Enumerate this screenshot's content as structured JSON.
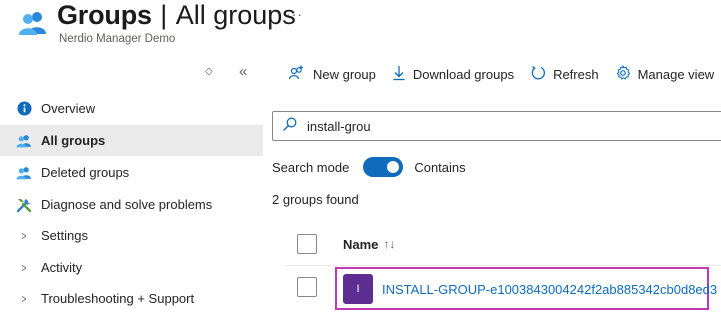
{
  "header": {
    "title_main": "Groups",
    "title_separator": "|",
    "title_sub": "All groups",
    "subtitle": "Nerdio Manager Demo",
    "more_label": "···",
    "icon": "groups-icon"
  },
  "sidebar": {
    "tools": {
      "updown": "◇",
      "collapse": "«"
    },
    "items": [
      {
        "label": "Overview",
        "icon": "info-icon",
        "active": false
      },
      {
        "label": "All groups",
        "icon": "groups-icon",
        "active": true
      },
      {
        "label": "Deleted groups",
        "icon": "groups-icon",
        "active": false
      },
      {
        "label": "Diagnose and solve problems",
        "icon": "wrench-icon",
        "active": false
      },
      {
        "label": "Settings",
        "icon": "chevron-right-icon",
        "active": false
      },
      {
        "label": "Activity",
        "icon": "chevron-right-icon",
        "active": false
      },
      {
        "label": "Troubleshooting + Support",
        "icon": "chevron-right-icon",
        "active": false
      }
    ]
  },
  "toolbar": {
    "new_group": "New group",
    "download_groups": "Download groups",
    "refresh": "Refresh",
    "manage_view": "Manage view"
  },
  "search": {
    "value": "install-grou",
    "icon": "search-icon"
  },
  "search_mode": {
    "label": "Search mode",
    "toggle_label": "Contains",
    "toggle_on": true
  },
  "results": {
    "count_text": "2 groups found",
    "column_name": "Name",
    "sort_icon": "↑↓",
    "rows": [
      {
        "avatar_letter": "I",
        "name": "INSTALL-GROUP-e1003843004242f2ab885342cb0d8ed3"
      }
    ]
  },
  "colors": {
    "accent": "#0f6cbd",
    "highlight": "#c239b3",
    "avatar": "#5c2e91"
  }
}
